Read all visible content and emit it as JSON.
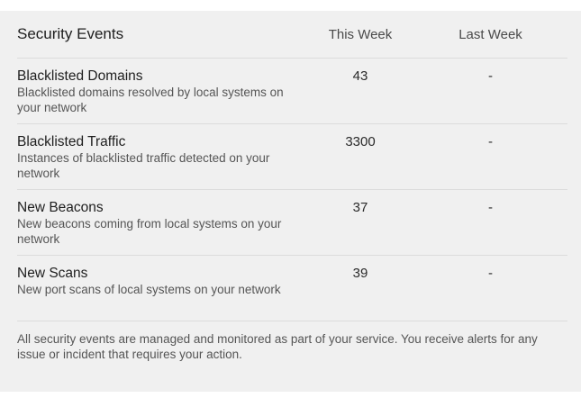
{
  "table": {
    "title": "Security Events",
    "col_this_week": "This Week",
    "col_last_week": "Last Week",
    "rows": [
      {
        "name": "Blacklisted Domains",
        "description": "Blacklisted domains resolved by local systems on your network",
        "this_week": "43",
        "last_week": "-"
      },
      {
        "name": "Blacklisted Traffic",
        "description": "Instances of blacklisted traffic detected on your network",
        "this_week": "3300",
        "last_week": "-"
      },
      {
        "name": "New Beacons",
        "description": "New beacons coming from local systems on your network",
        "this_week": "37",
        "last_week": "-"
      },
      {
        "name": "New Scans",
        "description": "New port scans of local systems on your network",
        "this_week": "39",
        "last_week": "-"
      }
    ]
  },
  "footer": {
    "note": "All security events are managed and monitored as part of your service. You receive alerts for any issue or incident that requires your action."
  }
}
